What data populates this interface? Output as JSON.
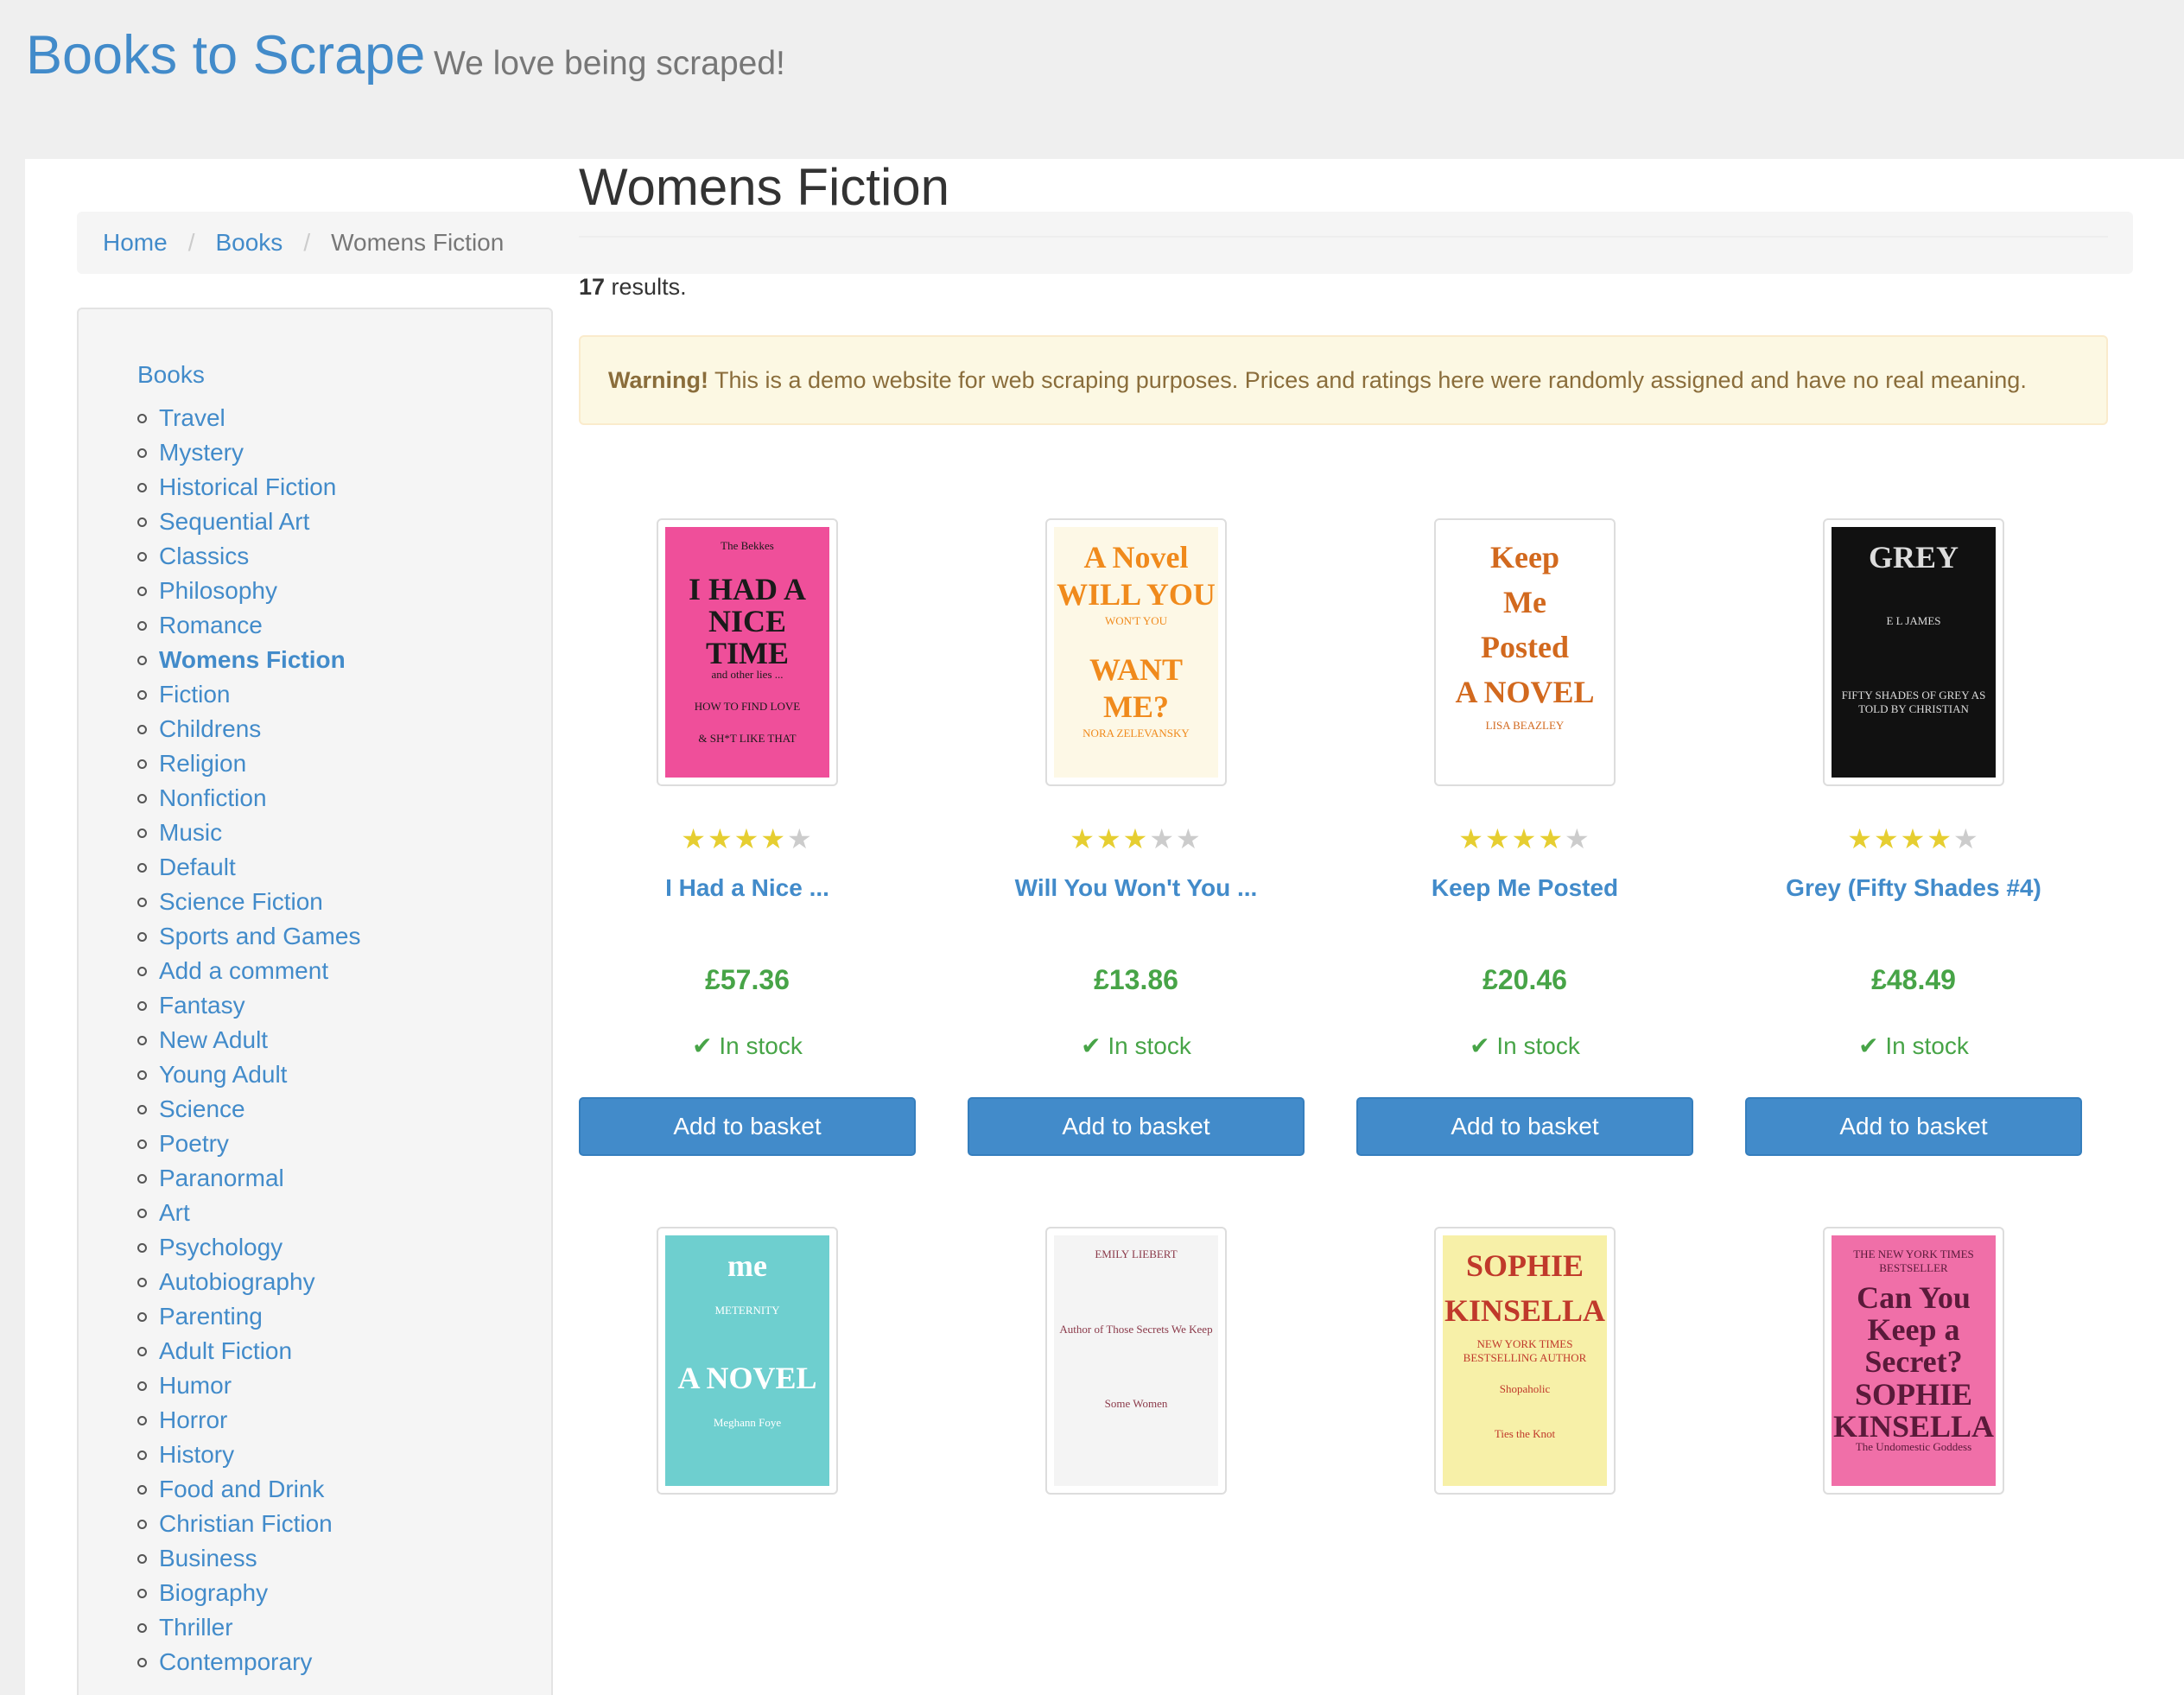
{
  "header": {
    "brand": "Books to Scrape",
    "tagline": "We love being scraped!"
  },
  "breadcrumb": {
    "home": "Home",
    "books": "Books",
    "current": "Womens Fiction"
  },
  "sidebar": {
    "root": "Books",
    "categories": [
      "Travel",
      "Mystery",
      "Historical Fiction",
      "Sequential Art",
      "Classics",
      "Philosophy",
      "Romance",
      "Womens Fiction",
      "Fiction",
      "Childrens",
      "Religion",
      "Nonfiction",
      "Music",
      "Default",
      "Science Fiction",
      "Sports and Games",
      "Add a comment",
      "Fantasy",
      "New Adult",
      "Young Adult",
      "Science",
      "Poetry",
      "Paranormal",
      "Art",
      "Psychology",
      "Autobiography",
      "Parenting",
      "Adult Fiction",
      "Humor",
      "Horror",
      "History",
      "Food and Drink",
      "Christian Fiction",
      "Business",
      "Biography",
      "Thriller",
      "Contemporary"
    ],
    "active_index": 7
  },
  "main": {
    "title": "Womens Fiction",
    "results_count": "17",
    "results_suffix": " results.",
    "warning_label": "Warning!",
    "warning_text": " This is a demo website for web scraping purposes. Prices and ratings here were randomly assigned and have no real meaning."
  },
  "products": [
    {
      "title": "I Had a Nice ...",
      "price": "£57.36",
      "stock": "In stock",
      "rating": 4,
      "button": "Add to basket",
      "cover": {
        "bg": "#ef4f9a",
        "fg": "#1a1a1a",
        "lines": [
          "The Bekkes",
          "I HAD A",
          "NICE",
          "TIME",
          "and other lies ...",
          "HOW TO FIND LOVE",
          "& SH*T LIKE THAT"
        ]
      }
    },
    {
      "title": "Will You Won't You ...",
      "price": "£13.86",
      "stock": "In stock",
      "rating": 3,
      "button": "Add to basket",
      "cover": {
        "bg": "#fdf8e6",
        "fg": "#f08a1c",
        "lines": [
          "A Novel",
          "WILL YOU",
          "WON'T YOU",
          "WANT",
          "ME?",
          "NORA ZELEVANSKY"
        ]
      }
    },
    {
      "title": "Keep Me Posted",
      "price": "£20.46",
      "stock": "In stock",
      "rating": 4,
      "button": "Add to basket",
      "cover": {
        "bg": "#ffffff",
        "fg": "#d2691e",
        "lines": [
          "Keep",
          "Me",
          "Posted",
          "A NOVEL",
          "LISA BEAZLEY"
        ]
      }
    },
    {
      "title": "Grey (Fifty Shades #4)",
      "price": "£48.49",
      "stock": "In stock",
      "rating": 4,
      "button": "Add to basket",
      "cover": {
        "bg": "#111111",
        "fg": "#dddddd",
        "lines": [
          "GREY",
          "E L JAMES",
          "FIFTY SHADES OF GREY AS TOLD BY CHRISTIAN"
        ]
      }
    },
    {
      "cover": {
        "bg": "#6ecfcf",
        "fg": "#ffffff",
        "lines": [
          "me",
          "METERNITY",
          "A NOVEL",
          "Meghann Foye"
        ]
      }
    },
    {
      "cover": {
        "bg": "#f4f4f4",
        "fg": "#8b3a4a",
        "lines": [
          "EMILY LIEBERT",
          "Author of Those Secrets We Keep",
          "Some Women"
        ]
      }
    },
    {
      "cover": {
        "bg": "#f7f0a8",
        "fg": "#c0392b",
        "lines": [
          "SOPHIE",
          "KINSELLA",
          "NEW YORK TIMES BESTSELLING AUTHOR",
          "Shopaholic",
          "Ties the Knot"
        ]
      }
    },
    {
      "cover": {
        "bg": "#f06fa8",
        "fg": "#5a1a3a",
        "lines": [
          "THE NEW YORK TIMES BESTSELLER",
          "Can You",
          "Keep a",
          "Secret?",
          "SOPHIE",
          "KINSELLA",
          "The Undomestic Goddess"
        ]
      }
    }
  ]
}
